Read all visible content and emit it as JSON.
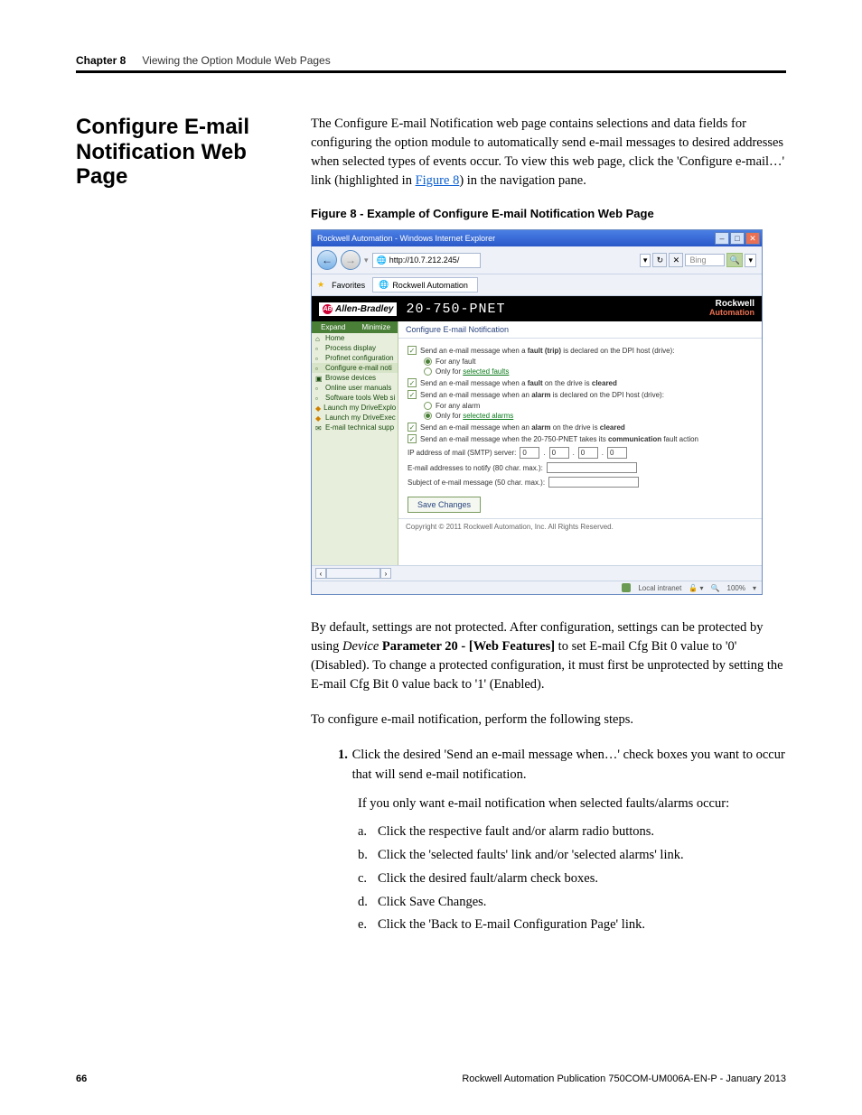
{
  "header": {
    "chapter_label": "Chapter 8",
    "chapter_title": "Viewing the Option Module Web Pages"
  },
  "section_title": "Configure E-mail Notification Web Page",
  "intro_text_1": "The Configure E-mail Notification web page contains selections and data fields for configuring the option module to automatically send e-mail messages to desired addresses when selected types of events occur. To view this web page, click the 'Configure e-mail…' link (highlighted in ",
  "intro_link": "Figure 8",
  "intro_text_2": ") in the navigation pane.",
  "fig_caption": "Figure 8 - Example of Configure E-mail Notification Web Page",
  "screenshot": {
    "window_title": "Rockwell Automation - Windows Internet Explorer",
    "url": "http://10.7.212.245/",
    "search_engine": "Bing",
    "favorites_label": "Favorites",
    "tab_label": "Rockwell Automation",
    "brand_ab": "Allen-Bradley",
    "device_name": "20-750-PNET",
    "brand_ra_line1": "Rockwell",
    "brand_ra_line2": "Automation",
    "nav_expand": "Expand",
    "nav_minimize": "Minimize",
    "nav_items": [
      "Home",
      "Process display",
      "Profinet configuration",
      "Configure e-mail noti",
      "Browse devices",
      "Online user manuals",
      "Software tools Web si",
      "Launch my DriveExplo",
      "Launch my DriveExec",
      "E-mail technical supp"
    ],
    "content_heading": "Configure E-mail Notification",
    "chk1_label_pre": "Send an e-mail message when a ",
    "chk1_bold": "fault (trip)",
    "chk1_label_post": " is declared on the DPI host (drive):",
    "rad1a": "For any fault",
    "rad1b_pre": "Only for ",
    "rad1b_link": "selected faults",
    "chk2_pre": "Send an e-mail message when a ",
    "chk2_bold": "fault",
    "chk2_post": " on the drive is ",
    "chk2_bold2": "cleared",
    "chk3_pre": "Send an e-mail message when an ",
    "chk3_bold": "alarm",
    "chk3_post": " is declared on the DPI host (drive):",
    "rad2a": "For any alarm",
    "rad2b_pre": "Only for ",
    "rad2b_link": "selected alarms",
    "chk4_pre": "Send an e-mail message when an ",
    "chk4_bold": "alarm",
    "chk4_mid": " on the drive is ",
    "chk4_bold2": "cleared",
    "chk5_pre": "Send an e-mail message when the 20-750-PNET takes its ",
    "chk5_bold": "communication",
    "chk5_post": " fault action",
    "ip_label": "IP address of mail (SMTP) server:",
    "ip_vals": [
      "0",
      "0",
      "0",
      "0"
    ],
    "emails_label": "E-mail addresses to notify (80 char. max.):",
    "subject_label": "Subject of e-mail message (50 char. max.):",
    "save_button": "Save Changes",
    "copyright": "Copyright © 2011 Rockwell Automation, Inc. All Rights Reserved.",
    "zone": "Local intranet",
    "zoom": "100%"
  },
  "para2_pre": "By default, settings are not protected. After configuration, settings can be protected by using ",
  "para2_italic": "Device",
  "para2_bold": " Parameter 20 - [Web Features] ",
  "para2_post": "to set E-mail Cfg Bit 0 value to '0' (Disabled). To change a protected configuration, it must first be unprotected by setting the E-mail Cfg Bit 0 value back to '1' (Enabled).",
  "para3": "To configure e-mail notification, perform the following steps.",
  "step1_num": "1.",
  "step1_text": "Click the desired 'Send an e-mail message when…' check boxes you want to occur that will send e-mail notification.",
  "step1_note": "If you only want e-mail notification when selected faults/alarms occur:",
  "sub_a_l": "a.",
  "sub_a": "Click the respective fault and/or alarm radio buttons.",
  "sub_b_l": "b.",
  "sub_b": "Click the 'selected faults' link and/or 'selected alarms' link.",
  "sub_c_l": "c.",
  "sub_c": "Click the desired fault/alarm check boxes.",
  "sub_d_l": "d.",
  "sub_d": "Click Save Changes.",
  "sub_e_l": "e.",
  "sub_e": "Click the 'Back to E-mail Configuration Page' link.",
  "footer": {
    "page_num": "66",
    "pub_info": "Rockwell Automation Publication 750COM-UM006A-EN-P - January 2013"
  }
}
